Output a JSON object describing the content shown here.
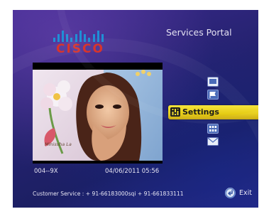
{
  "brand": {
    "logo_text": "CISCO"
  },
  "header": {
    "title": "Services Portal"
  },
  "video": {
    "overlay_text": "Minissha La"
  },
  "menu": {
    "items": [
      {
        "icon": "tv-icon",
        "label": ""
      },
      {
        "icon": "flag-icon",
        "label": ""
      },
      {
        "icon": "settings-icon",
        "label": "Settings",
        "selected": true
      },
      {
        "icon": "grid-icon",
        "label": ""
      },
      {
        "icon": "mail-icon",
        "label": ""
      }
    ]
  },
  "status": {
    "channel": "004--9X",
    "datetime": "04/06/2011 05:56"
  },
  "footer": {
    "customer_service": "Customer Service : + 91-66183000sqi + 91-661833111",
    "exit_label": "Exit"
  },
  "colors": {
    "selection": "#f0dc2a",
    "background": "#2a2780",
    "logo_red": "#d8342c",
    "logo_blue": "#1f8fd6"
  }
}
